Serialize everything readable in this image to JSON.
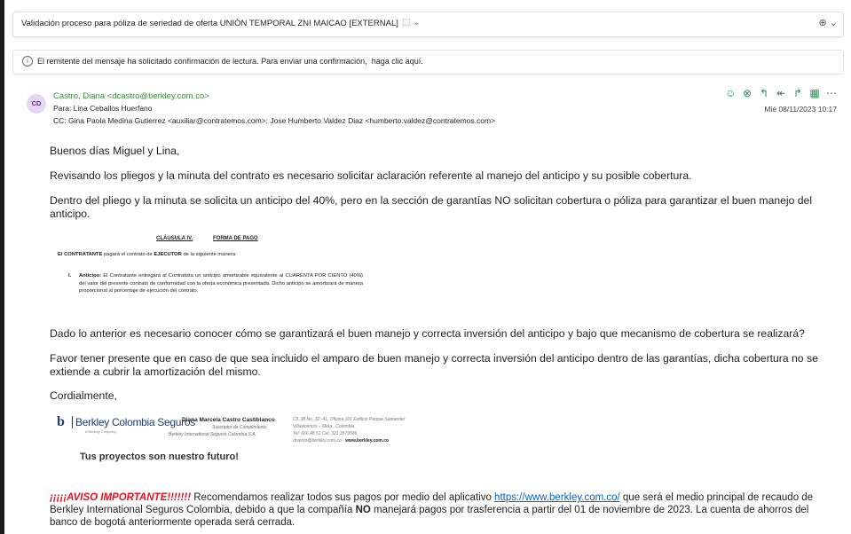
{
  "subject": {
    "title": "Validación proceso para póliza de seriedad de oferta UNIÓN TEMPORAL ZNI MAICAO [EXTERNAL]",
    "tag_icon": "tag-icon",
    "zoom_icon": "zoom-icon"
  },
  "read_receipt": {
    "text": "El remitente del mensaje ha solicitado confirmación de lectura. Para enviar una confirmación,",
    "link": "haga clic aquí."
  },
  "header": {
    "avatar_initials": "CD",
    "from": "Castro, Diana <dcastro@berkley.com.co>",
    "to": "Para: Lina Ceballos Huerfano",
    "cc": "CC: Gina Paola Medina Gutierrez <auxiliar@contratemos.com>;  Jose Humberto Valdez Diaz <humberto.valdez@contratemos.com>",
    "date": "Mié 08/11/2023 10:17",
    "actions": [
      "emoji-icon",
      "loop-icon",
      "reply-icon",
      "reply-all-icon",
      "forward-icon",
      "apps-icon",
      "more-icon"
    ]
  },
  "body": {
    "greeting": "Buenos días Miguel y Lina,",
    "p1": "Revisando los pliegos y la minuta del contrato es necesario solicitar aclaración referente al manejo del anticipo y su posible cobertura.",
    "p2_line1": "Dentro del pliego y la minuta se solicita un anticipo del 40%, pero en la sección de garantías NO solicitan cobertura o póliza para garantizar el buen manejo del",
    "p2_line2": "anticipo.",
    "p3": "Dado lo anterior es necesario conocer cómo se garantizará el buen manejo y correcta inversión del anticipo y bajo que mecanismo de cobertura se realizará?",
    "p4_line1": "Favor tener presente que en caso de que sea incluido el amparo de buen manejo y correcta inversión del anticipo dentro de las garantías, dicha cobertura no se",
    "p4_line2": "extiende a cubrir la amortización del mismo.",
    "closing": "Cordialmente,"
  },
  "contract_image": {
    "clause": "CLÁUSULA IV.",
    "clause_name": "FORMA DE PAGO",
    "intro_b1": "El CONTRATANTE",
    "intro_t1": " pagará el contrato de ",
    "intro_b2": "EJECUTOR",
    "intro_t2": " de la siguiente manera:",
    "item_num": "I.",
    "item_label": "Anticipo:",
    "item_text": " El Contratante entregará al Contratista un anticipo amortizable equivalente al CUARENTA POR CIENTO (40%) del valor del presente contrato de conformidad con la oferta económica presentada. Dicho anticipo se amortizará de manera proporcional al porcentaje de ejecución del contrato."
  },
  "signature": {
    "logo_text_1": "Berkley",
    "logo_text_2": "Colombia Seguros",
    "logo_sub": "a Berkley Company",
    "person": "Diana Marcela Castro Castiblanco",
    "role1": "Suscriptor de Cumplimiento",
    "role2": "Berkley International Seguros Colombia S.A.",
    "addr1": "Cll. 38 No. 32 -41, Oficina 101 Edificio Parque Santander",
    "addr2": "Villavicencio – Meta , Colombia",
    "addr3": "Tel: 666 48 51 Cel: 321 3579586",
    "addr4_email": "dcastro@berkley.com.co - ",
    "addr4_web": "www.berkley.com.co",
    "tagline": "Tus proyectos son nuestro futuro!"
  },
  "notice": {
    "warn": "¡¡¡¡¡AVISO IMPORTANTE!!!!!!!",
    "t1": " Recomendamos realizar todos sus pagos por medio del aplicativo ",
    "link": "https://www.berkley.com.co/",
    "t2": " que será el medio principal de recaudo de Berkley International Seguros Colombia, debido a que la compañía ",
    "bold": "NO",
    "t3": " manejará pagos por trasferencia a partir del 01 de noviembre de 2023. La cuenta de ahorros del banco de bogotá anteriormente operada será cerrada."
  }
}
